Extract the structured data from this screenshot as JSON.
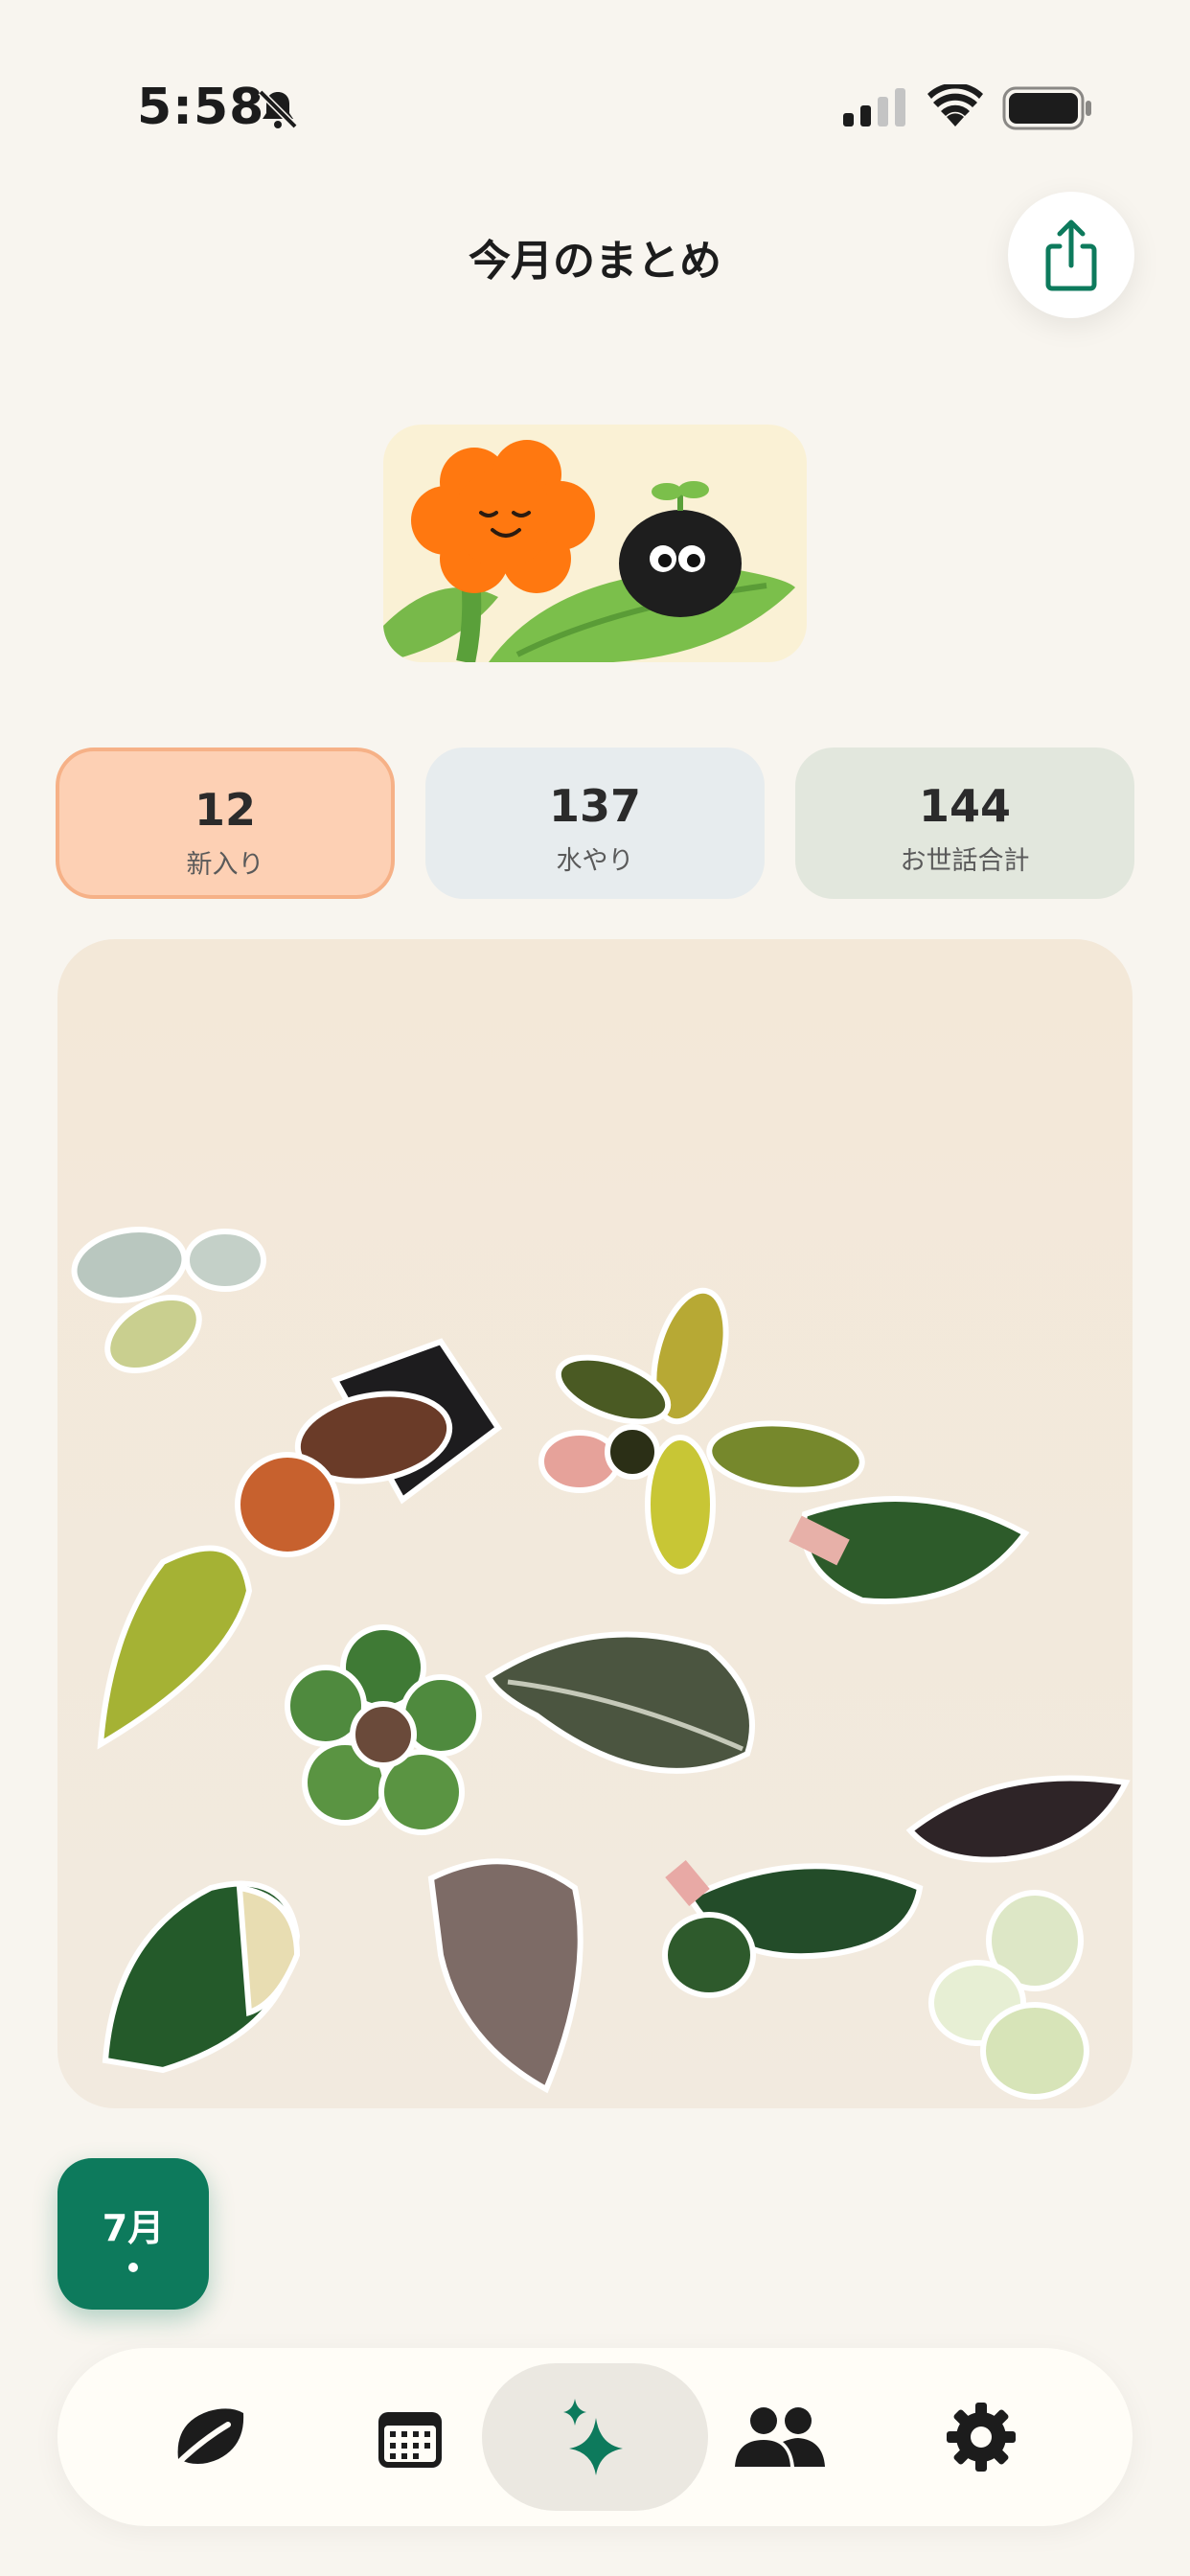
{
  "status_bar": {
    "time": "5:58"
  },
  "header": {
    "title": "今月のまとめ"
  },
  "stats": [
    {
      "value": "12",
      "label": "新入り"
    },
    {
      "value": "137",
      "label": "水やり"
    },
    {
      "value": "144",
      "label": "お世話合計"
    }
  ],
  "month_selector": {
    "label": "7月"
  },
  "tab_bar": {
    "tabs": [
      {
        "icon": "leaf-icon"
      },
      {
        "icon": "calendar-icon"
      },
      {
        "icon": "sparkles-icon",
        "selected": true
      },
      {
        "icon": "people-icon"
      },
      {
        "icon": "gear-icon"
      }
    ]
  },
  "colors": {
    "accent": "#0d7a5c",
    "background": "#f8f5ef",
    "new_card": "#fdd0b4",
    "water_card": "#e7ecee",
    "care_card": "#e2e7dd"
  }
}
